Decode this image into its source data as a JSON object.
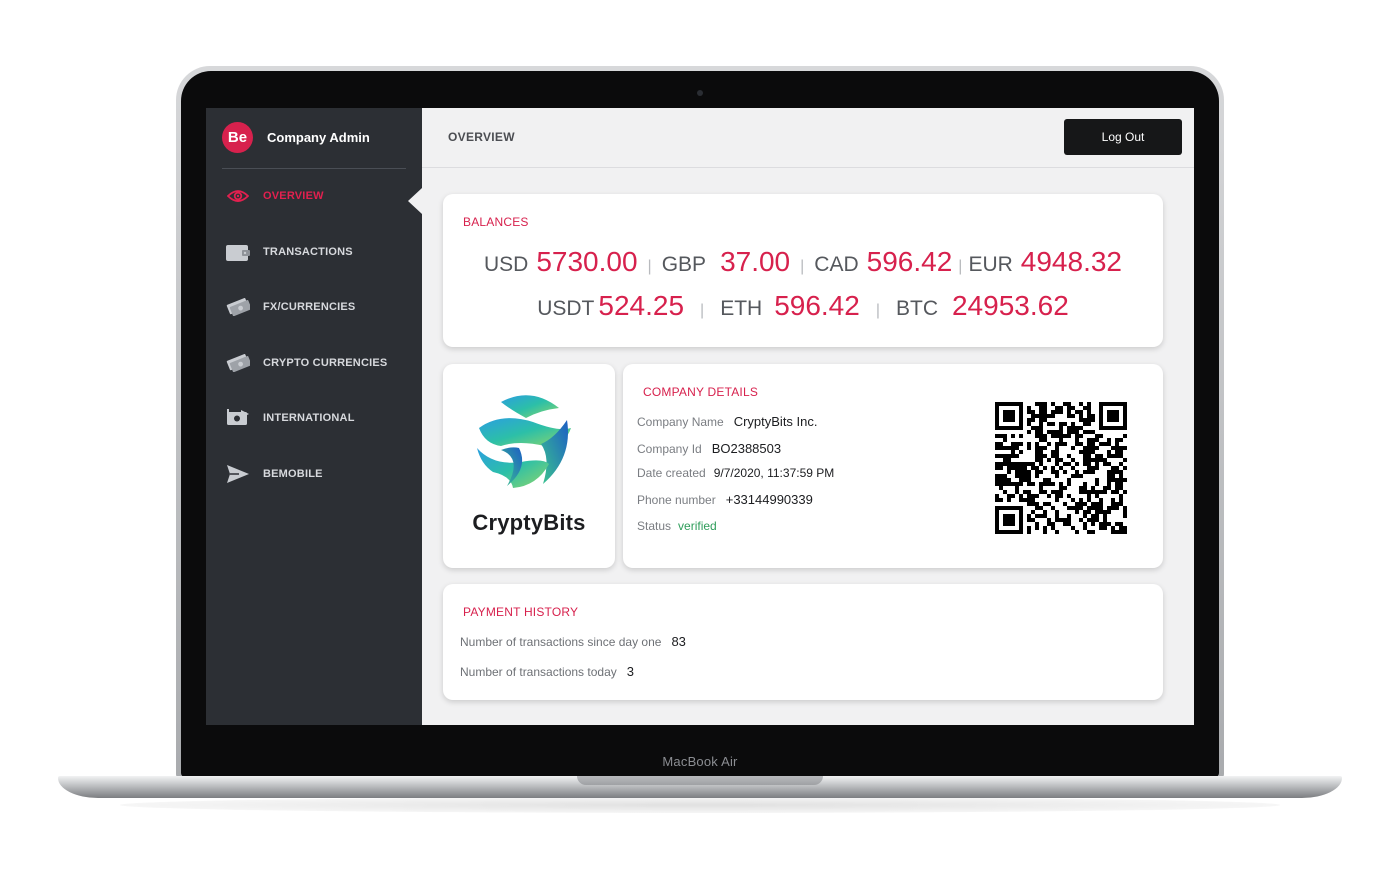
{
  "device": {
    "label": "MacBook Air"
  },
  "sidebar": {
    "brand_logo": "Be",
    "brand_title": "Company Admin",
    "items": [
      {
        "label": "OVERVIEW",
        "icon": "eye-icon",
        "active": true
      },
      {
        "label": "TRANSACTIONS",
        "icon": "wallet-icon",
        "active": false
      },
      {
        "label": "FX/CURRENCIES",
        "icon": "money-icon",
        "active": false
      },
      {
        "label": "CRYPTO CURRENCIES",
        "icon": "money-icon",
        "active": false
      },
      {
        "label": "INTERNATIONAL",
        "icon": "transfer-icon",
        "active": false
      },
      {
        "label": "BEMOBILE",
        "icon": "send-icon",
        "active": false
      }
    ]
  },
  "header": {
    "title": "OVERVIEW",
    "logout_label": "Log Out"
  },
  "balances": {
    "title": "BALANCES",
    "row1": [
      {
        "code": "USD",
        "value": "5730.00"
      },
      {
        "code": "GBP",
        "value": "37.00"
      },
      {
        "code": "CAD",
        "value": "596.42"
      },
      {
        "code": "EUR",
        "value": "4948.32"
      }
    ],
    "row2": [
      {
        "code": "USDT",
        "value": "524.25"
      },
      {
        "code": "ETH",
        "value": "596.42"
      },
      {
        "code": "BTC",
        "value": "24953.62"
      }
    ],
    "separator": "|"
  },
  "company_logo": {
    "name": "CryptyBits"
  },
  "company_details": {
    "title": "COMPANY DETAILS",
    "fields": [
      {
        "label": "Company Name",
        "value": "CryptyBits Inc."
      },
      {
        "label": "Company Id",
        "value": "BO2388503"
      },
      {
        "label": "Date created",
        "value": "9/7/2020, 11:37:59 PM"
      },
      {
        "label": "Phone number",
        "value": "+33144990339"
      },
      {
        "label": "Status",
        "value": "verified"
      }
    ]
  },
  "payment_history": {
    "title": "PAYMENT HISTORY",
    "rows": [
      {
        "label": "Number of transactions since day one",
        "value": "83"
      },
      {
        "label": "Number of transactions today",
        "value": "3"
      }
    ]
  },
  "colors": {
    "accent": "#d7214d",
    "sidebar": "#2c2f34",
    "status_verified": "#2e9d5a",
    "logout_button": "#161718"
  }
}
